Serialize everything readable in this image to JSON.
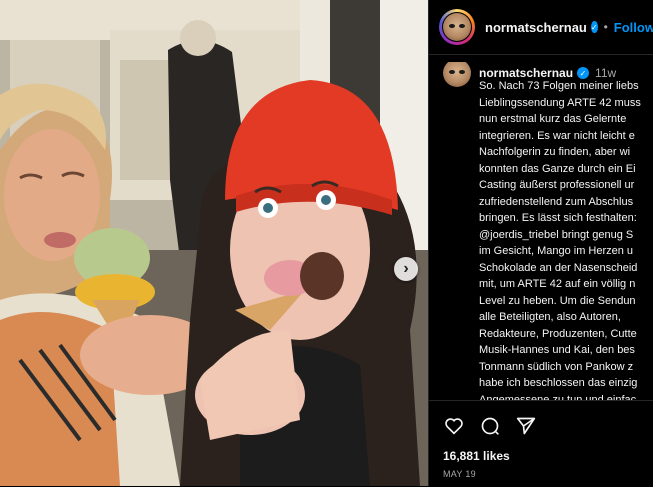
{
  "post": {
    "username": "normatschernau",
    "follow_label": "Follow",
    "separator": "•",
    "verified_glyph": "✓",
    "carousel_next_glyph": "›"
  },
  "caption": {
    "username": "normatschernau",
    "time": "11w",
    "lines": [
      "So. Nach 73 Folgen meiner liebs",
      "Lieblingssendung ARTE 42 muss",
      "nun erstmal kurz das Gelernte",
      "integrieren. Es war nicht leicht e",
      "Nachfolgerin zu finden, aber wi",
      "konnten das Ganze durch ein Ei",
      "Casting äußerst professionell ur",
      "zufriedenstellend zum Abschlus",
      "bringen. Es lässt sich festhalten:",
      "@joerdis_triebel bringt genug S",
      "im Gesicht, Mango im Herzen u",
      "Schokolade an der Nasenscheid",
      "mit, um ARTE 42 auf ein völlig n",
      "Level zu heben. Um die Sendun",
      "alle Beteiligten, also Autoren,",
      "Redakteure, Produzenten, Cutte",
      "Musik-Hannes und Kai, den bes",
      "Tonmann südlich von Pankow z",
      "habe ich beschlossen das einzig",
      "Angemessene zu tun und einfac"
    ]
  },
  "engagement": {
    "likes": "16,881 likes",
    "date": "MAY 19"
  },
  "colors": {
    "accent": "#0095f6",
    "background": "#000000",
    "border": "#262626",
    "muted": "#a8a8a8"
  },
  "icons": [
    "heart-icon",
    "comment-icon",
    "share-icon",
    "verified-badge-icon",
    "chevron-right-icon"
  ]
}
